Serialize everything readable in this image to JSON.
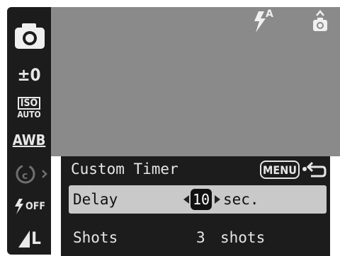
{
  "sidebar": {
    "items": [
      {
        "icon": "camera-icon",
        "label": ""
      },
      {
        "icon": "exposure-compensation-icon",
        "label": "±0"
      },
      {
        "icon": "iso-icon",
        "label": "ISO",
        "sub": "AUTO"
      },
      {
        "icon": "white-balance-icon",
        "label": "AWB"
      },
      {
        "icon": "self-timer-custom-icon",
        "label": ""
      },
      {
        "icon": "flash-off-icon",
        "label": "OFF"
      },
      {
        "icon": "image-size-icon",
        "label": "L"
      }
    ]
  },
  "status": {
    "flash_icon": "flash-auto-icon",
    "flash_label": "A",
    "mode_icon": "camera-mode-icon"
  },
  "menu": {
    "title": "Custom Timer",
    "menu_button_label": "MENU",
    "back_icon": "return-arrow-icon",
    "rows": [
      {
        "label": "Delay",
        "value": "10",
        "unit": "sec.",
        "selected": true
      },
      {
        "label": "Shots",
        "value": "3",
        "unit": "shots",
        "selected": false
      }
    ]
  },
  "colors": {
    "panel": "#1c1c1c",
    "lcd": "#8a8a8a",
    "selected_row": "#c9c9c9",
    "text_light": "#e6e6e6"
  }
}
